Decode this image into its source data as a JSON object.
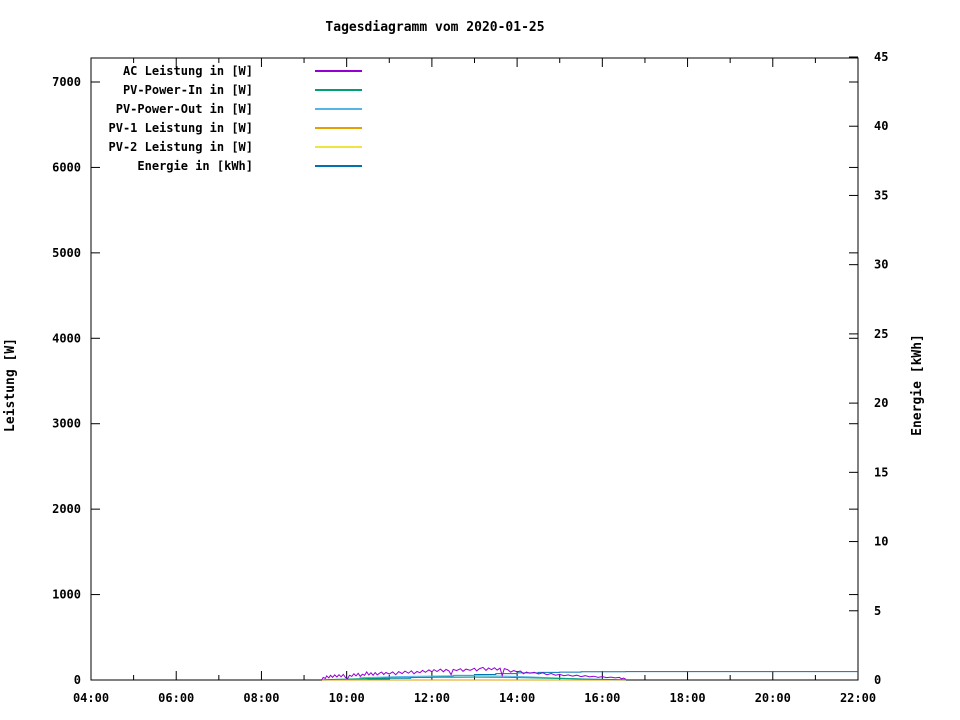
{
  "title": "Tagesdiagramm vom 2020-01-25",
  "chart_data": {
    "type": "line",
    "title": "Tagesdiagramm vom 2020-01-25",
    "grid": false,
    "legend_position": "top-left",
    "x_axis": {
      "unit": "time",
      "range_hours": [
        4,
        22
      ],
      "major_ticks": [
        {
          "h": 4,
          "label": "04:00"
        },
        {
          "h": 6,
          "label": "06:00"
        },
        {
          "h": 8,
          "label": "08:00"
        },
        {
          "h": 10,
          "label": "10:00"
        },
        {
          "h": 12,
          "label": "12:00"
        },
        {
          "h": 14,
          "label": "14:00"
        },
        {
          "h": 16,
          "label": "16:00"
        },
        {
          "h": 18,
          "label": "18:00"
        },
        {
          "h": 20,
          "label": "20:00"
        },
        {
          "h": 22,
          "label": "22:00"
        }
      ],
      "minor_tick_hours": [
        5,
        7,
        9,
        11,
        13,
        15,
        17,
        19,
        21
      ]
    },
    "y_left": {
      "label": "Leistung [W]",
      "range": [
        0,
        7280
      ],
      "ticks": [
        0,
        1000,
        2000,
        3000,
        4000,
        5000,
        6000,
        7000
      ]
    },
    "y_right": {
      "label": "Energie [kWh]",
      "range": [
        0,
        45
      ],
      "ticks": [
        0,
        5,
        10,
        15,
        20,
        25,
        30,
        35,
        40,
        45
      ]
    },
    "series": [
      {
        "name": "AC Leistung in [W]",
        "color": "#9400d3",
        "axis": "left",
        "step": false,
        "points": [
          [
            9.42,
            5
          ],
          [
            9.45,
            30
          ],
          [
            9.5,
            18
          ],
          [
            9.53,
            48
          ],
          [
            9.58,
            25
          ],
          [
            9.62,
            55
          ],
          [
            9.67,
            30
          ],
          [
            9.72,
            60
          ],
          [
            9.77,
            35
          ],
          [
            9.82,
            62
          ],
          [
            9.87,
            38
          ],
          [
            9.92,
            66
          ],
          [
            9.97,
            30
          ],
          [
            10.02,
            14
          ],
          [
            10.07,
            55
          ],
          [
            10.12,
            42
          ],
          [
            10.17,
            72
          ],
          [
            10.22,
            48
          ],
          [
            10.27,
            78
          ],
          [
            10.32,
            42
          ],
          [
            10.37,
            68
          ],
          [
            10.42,
            55
          ],
          [
            10.47,
            95
          ],
          [
            10.52,
            58
          ],
          [
            10.57,
            84
          ],
          [
            10.62,
            55
          ],
          [
            10.67,
            88
          ],
          [
            10.72,
            60
          ],
          [
            10.77,
            80
          ],
          [
            10.82,
            92
          ],
          [
            10.87,
            64
          ],
          [
            10.92,
            88
          ],
          [
            11.0,
            70
          ],
          [
            11.08,
            95
          ],
          [
            11.15,
            62
          ],
          [
            11.22,
            98
          ],
          [
            11.3,
            75
          ],
          [
            11.37,
            104
          ],
          [
            11.45,
            80
          ],
          [
            11.52,
            108
          ],
          [
            11.58,
            72
          ],
          [
            11.65,
            100
          ],
          [
            11.72,
            86
          ],
          [
            11.78,
            112
          ],
          [
            11.85,
            90
          ],
          [
            11.93,
            118
          ],
          [
            12.0,
            95
          ],
          [
            12.05,
            122
          ],
          [
            12.12,
            100
          ],
          [
            12.2,
            128
          ],
          [
            12.27,
            96
          ],
          [
            12.33,
            124
          ],
          [
            12.4,
            106
          ],
          [
            12.45,
            62
          ],
          [
            12.5,
            124
          ],
          [
            12.58,
            110
          ],
          [
            12.67,
            132
          ],
          [
            12.73,
            102
          ],
          [
            12.8,
            128
          ],
          [
            12.9,
            114
          ],
          [
            13.0,
            138
          ],
          [
            13.05,
            106
          ],
          [
            13.12,
            134
          ],
          [
            13.2,
            148
          ],
          [
            13.27,
            112
          ],
          [
            13.33,
            140
          ],
          [
            13.4,
            120
          ],
          [
            13.47,
            144
          ],
          [
            13.53,
            116
          ],
          [
            13.6,
            138
          ],
          [
            13.65,
            52
          ],
          [
            13.7,
            134
          ],
          [
            13.78,
            120
          ],
          [
            13.85,
            92
          ],
          [
            13.92,
            110
          ],
          [
            14.0,
            96
          ],
          [
            14.08,
            104
          ],
          [
            14.15,
            72
          ],
          [
            14.22,
            94
          ],
          [
            14.3,
            80
          ],
          [
            14.4,
            90
          ],
          [
            14.5,
            70
          ],
          [
            14.6,
            84
          ],
          [
            14.7,
            62
          ],
          [
            14.8,
            76
          ],
          [
            14.9,
            56
          ],
          [
            15.0,
            66
          ],
          [
            15.1,
            50
          ],
          [
            15.2,
            60
          ],
          [
            15.3,
            46
          ],
          [
            15.4,
            56
          ],
          [
            15.5,
            40
          ],
          [
            15.6,
            50
          ],
          [
            15.7,
            36
          ],
          [
            15.8,
            44
          ],
          [
            15.9,
            30
          ],
          [
            16.0,
            40
          ],
          [
            16.1,
            28
          ],
          [
            16.2,
            34
          ],
          [
            16.3,
            24
          ],
          [
            16.4,
            30
          ],
          [
            16.45,
            14
          ],
          [
            16.5,
            22
          ],
          [
            16.55,
            8
          ]
        ]
      },
      {
        "name": "PV-Power-In in [W]",
        "color": "#009e73",
        "axis": "left",
        "step": false,
        "points": [
          [
            9.45,
            4
          ],
          [
            9.8,
            8
          ],
          [
            10.1,
            12
          ],
          [
            10.4,
            16
          ],
          [
            10.7,
            20
          ],
          [
            11.0,
            24
          ],
          [
            11.4,
            27
          ],
          [
            11.8,
            30
          ],
          [
            12.2,
            32
          ],
          [
            12.6,
            33
          ],
          [
            13.0,
            34
          ],
          [
            13.4,
            32
          ],
          [
            13.8,
            30
          ],
          [
            14.2,
            26
          ],
          [
            14.6,
            22
          ],
          [
            15.0,
            17
          ],
          [
            15.4,
            13
          ],
          [
            15.8,
            9
          ],
          [
            16.2,
            6
          ],
          [
            16.55,
            2
          ]
        ]
      },
      {
        "name": "PV-Power-Out in [W]",
        "color": "#56b4e9",
        "axis": "left",
        "step": false,
        "points": [
          [
            10.3,
            26
          ],
          [
            10.7,
            32
          ],
          [
            11.1,
            38
          ],
          [
            11.5,
            42
          ],
          [
            11.9,
            46
          ],
          [
            12.3,
            48
          ],
          [
            12.7,
            50
          ],
          [
            13.1,
            50
          ],
          [
            13.5,
            47
          ],
          [
            13.9,
            42
          ],
          [
            14.3,
            36
          ],
          [
            14.7,
            28
          ],
          [
            15.1,
            20
          ],
          [
            15.5,
            13
          ],
          [
            15.9,
            8
          ],
          [
            16.3,
            4
          ]
        ]
      },
      {
        "name": "PV-1 Leistung in [W]",
        "color": "#e69f00",
        "axis": "left",
        "step": false,
        "points": [
          [
            9.42,
            0
          ],
          [
            16.55,
            0
          ]
        ]
      },
      {
        "name": "PV-2 Leistung in [W]",
        "color": "#f0e442",
        "axis": "left",
        "step": false,
        "points": [
          [
            9.42,
            0
          ],
          [
            16.55,
            0
          ]
        ]
      },
      {
        "name": "Energie in [kWh]",
        "color": "#0072b2",
        "axis": "right",
        "step": true,
        "points": [
          [
            9.42,
            0
          ],
          [
            10.0,
            0.03
          ],
          [
            10.5,
            0.07
          ],
          [
            11.0,
            0.12
          ],
          [
            11.5,
            0.19
          ],
          [
            12.0,
            0.26
          ],
          [
            12.5,
            0.33
          ],
          [
            13.0,
            0.4
          ],
          [
            13.5,
            0.46
          ],
          [
            14.0,
            0.51
          ],
          [
            14.5,
            0.55
          ],
          [
            15.0,
            0.57
          ],
          [
            15.5,
            0.59
          ],
          [
            16.0,
            0.6
          ],
          [
            16.55,
            0.61
          ],
          [
            22.0,
            0.61
          ]
        ]
      }
    ]
  }
}
